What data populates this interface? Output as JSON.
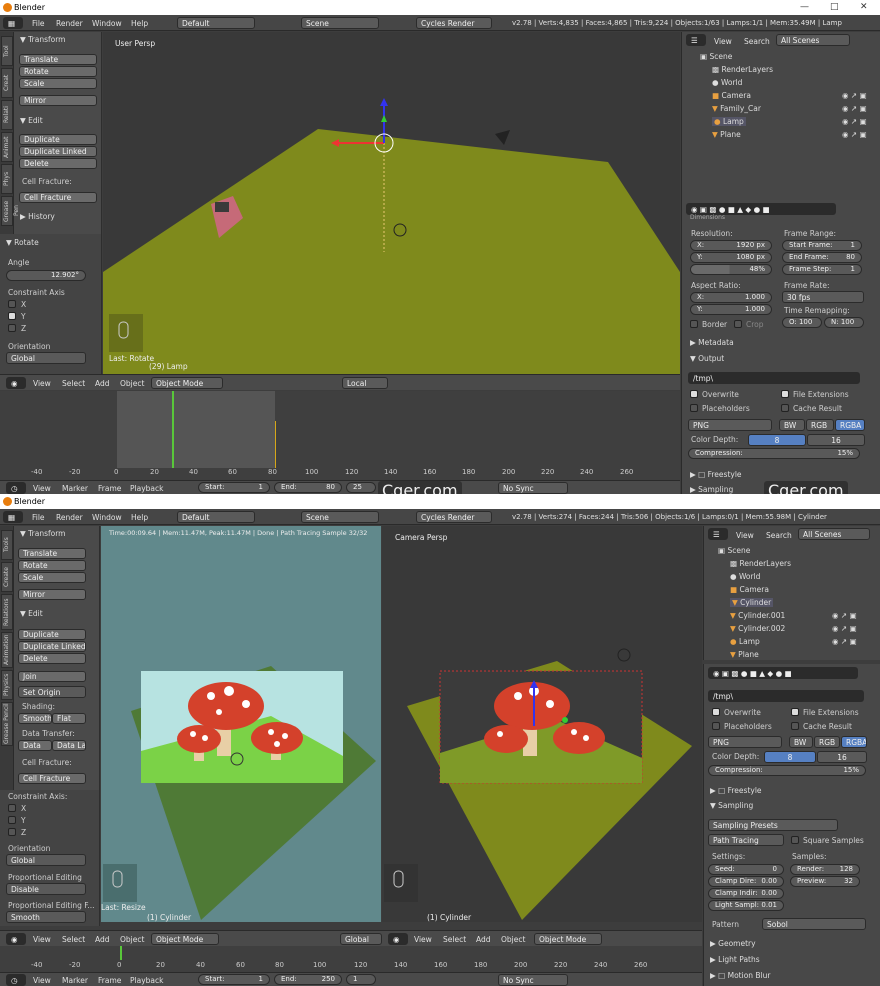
{
  "top": {
    "title": "Blender",
    "menu": [
      "File",
      "Render",
      "Window",
      "Help"
    ],
    "layout": "Default",
    "scene": "Scene",
    "engine": "Cycles Render",
    "stats": "v2.78 | Verts:4,835 | Faces:4,865 | Tris:9,224 | Objects:1/63 | Lamps:1/1 | Mem:35.49M | Lamp",
    "tool": {
      "transform": "Transform",
      "buttons": [
        "Translate",
        "Rotate",
        "Scale",
        "Mirror"
      ],
      "edit": "Edit",
      "edit_buttons": [
        "Duplicate",
        "Duplicate Linked",
        "Delete"
      ],
      "cell_fracture_label": "Cell Fracture:",
      "cell_fracture": "Cell Fracture",
      "history": "History",
      "rotate": "Rotate",
      "angle_label": "Angle",
      "angle": "12.902°",
      "constraint_axis": "Constraint Axis",
      "axes": [
        "X",
        "Y",
        "Z"
      ],
      "orientation": "Orientation",
      "orientation_value": "Global",
      "tabs": [
        "Tool",
        "Creat",
        "Relati",
        "Animat",
        "Phys",
        "Grease Pen"
      ]
    },
    "viewport": {
      "label": "User Persp",
      "last": "Last: Rotate",
      "object": "(29) Lamp",
      "header": [
        "View",
        "Select",
        "Add",
        "Object"
      ],
      "mode": "Object Mode",
      "pivot": "Local"
    },
    "timeline": {
      "ticks": [
        "-40",
        "-20",
        "0",
        "20",
        "40",
        "60",
        "80",
        "100",
        "120",
        "140",
        "160",
        "180",
        "200",
        "220",
        "240",
        "260"
      ],
      "menu": [
        "View",
        "Marker",
        "Frame",
        "Playback"
      ],
      "start": "Start:",
      "start_v": "1",
      "end": "End:",
      "end_v": "80",
      "current": "25",
      "sync": "No Sync"
    },
    "outliner": {
      "menu": [
        "View",
        "Search"
      ],
      "filter": "All Scenes",
      "items": [
        "Scene",
        "RenderLayers",
        "World",
        "Camera",
        "Family_Car",
        "Lamp",
        "Plane"
      ]
    },
    "props": {
      "dimensions": "Dimensions",
      "resolution": "Resolution:",
      "res_x": "1920 px",
      "res_y": "1080 px",
      "res_pct": "48%",
      "frame_range": "Frame Range:",
      "start_frame": "Start Frame:",
      "start_frame_v": "1",
      "end_frame": "End Frame:",
      "end_frame_v": "80",
      "frame_step": "Frame Step:",
      "frame_step_v": "1",
      "aspect": "Aspect Ratio:",
      "asp_x": "1.000",
      "asp_y": "1.000",
      "frame_rate": "Frame Rate:",
      "fps": "30 fps",
      "time_remap": "Time Remapping:",
      "old": "O: 100",
      "new": "N: 100",
      "border": "Border",
      "crop": "Crop",
      "metadata": "Metadata",
      "output": "Output",
      "path": "/tmp\\",
      "overwrite": "Overwrite",
      "file_ext": "File Extensions",
      "placeholders": "Placeholders",
      "cache": "Cache Result",
      "format": "PNG",
      "bw": "BW",
      "rgb": "RGB",
      "rgba": "RGBA",
      "color_depth": "Color Depth:",
      "d8": "8",
      "d16": "16",
      "compression": "Compression:",
      "comp_v": "15%",
      "freestyle": "Freestyle",
      "sampling": "Sampling"
    },
    "watermarks": [
      "Cger.com",
      "Cger.com"
    ]
  },
  "bottom": {
    "title": "Blender",
    "menu": [
      "File",
      "Render",
      "Window",
      "Help"
    ],
    "layout": "Default",
    "scene": "Scene",
    "engine": "Cycles Render",
    "stats": "v2.78 | Verts:274 | Faces:244 | Tris:506 | Objects:1/6 | Lamps:0/1 | Mem:55.98M | Cylinder",
    "tool": {
      "transform": "Transform",
      "buttons": [
        "Translate",
        "Rotate",
        "Scale",
        "Mirror"
      ],
      "edit": "Edit",
      "edit_buttons": [
        "Duplicate",
        "Duplicate Linked",
        "Delete"
      ],
      "join": "Join",
      "set_origin": "Set Origin",
      "shading": "Shading:",
      "smooth": "Smooth",
      "flat": "Flat",
      "data_transfer": "Data Transfer:",
      "data": "Data",
      "data_la": "Data La",
      "cell_fracture_label": "Cell Fracture:",
      "cell_fracture": "Cell Fracture",
      "constraint_axis": "Constraint Axis:",
      "axes": [
        "X",
        "Y",
        "Z"
      ],
      "orientation": "Orientation",
      "orientation_value": "Global",
      "prop_edit": "Proportional Editing",
      "prop_value": "Disable",
      "prop_falloff": "Proportional Editing F...",
      "falloff_value": "Smooth",
      "tabs": [
        "Tools",
        "Create",
        "Relations",
        "Animation",
        "Physics",
        "Grease Pencil"
      ]
    },
    "render_view": {
      "status": "Time:00:09.64 | Mem:11.47M, Peak:11.47M | Done | Path Tracing Sample 32/32",
      "last": "Last: Resize",
      "object": "(1) Cylinder"
    },
    "cam_view": {
      "label": "Camera Persp",
      "object": "(1) Cylinder"
    },
    "header": [
      "View",
      "Select",
      "Add",
      "Object"
    ],
    "mode": "Object Mode",
    "global": "Global",
    "timeline": {
      "ticks": [
        "-40",
        "-20",
        "0",
        "20",
        "40",
        "60",
        "80",
        "100",
        "120",
        "140",
        "160",
        "180",
        "200",
        "220",
        "240",
        "260"
      ],
      "menu": [
        "View",
        "Marker",
        "Frame",
        "Playback"
      ],
      "start": "Start:",
      "start_v": "1",
      "end": "End:",
      "end_v": "250",
      "current": "1",
      "sync": "No Sync"
    },
    "outliner": {
      "menu": [
        "View",
        "Search"
      ],
      "filter": "All Scenes",
      "items": [
        "Scene",
        "RenderLayers",
        "World",
        "Camera",
        "Cylinder",
        "Cylinder.001",
        "Cylinder.002",
        "Lamp",
        "Plane"
      ]
    },
    "props": {
      "path": "/tmp\\",
      "overwrite": "Overwrite",
      "file_ext": "File Extensions",
      "placeholders": "Placeholders",
      "cache": "Cache Result",
      "format": "PNG",
      "bw": "BW",
      "rgb": "RGB",
      "rgba": "RGBA",
      "color_depth": "Color Depth:",
      "d8": "8",
      "d16": "16",
      "compression": "Compression:",
      "comp_v": "15%",
      "freestyle": "Freestyle",
      "sampling": "Sampling",
      "presets": "Sampling Presets",
      "method": "Path Tracing",
      "square": "Square Samples",
      "settings": "Settings:",
      "samples": "Samples:",
      "seed": "Seed:",
      "seed_v": "0",
      "render": "Render:",
      "render_v": "128",
      "clamp_direct": "Clamp Dire:",
      "clamp_direct_v": "0.00",
      "preview": "Preview:",
      "preview_v": "32",
      "clamp_indirect": "Clamp Indir:",
      "clamp_indirect_v": "0.00",
      "light_sample": "Light Sampl:",
      "light_sample_v": "0.01",
      "pattern": "Pattern",
      "pattern_v": "Sobol",
      "geometry": "Geometry",
      "light_paths": "Light Paths",
      "motion_blur": "Motion Blur"
    }
  },
  "colors": {
    "accent": "#5680c2",
    "ground": "#7f8a1c",
    "mushroom": "#d4412b"
  }
}
